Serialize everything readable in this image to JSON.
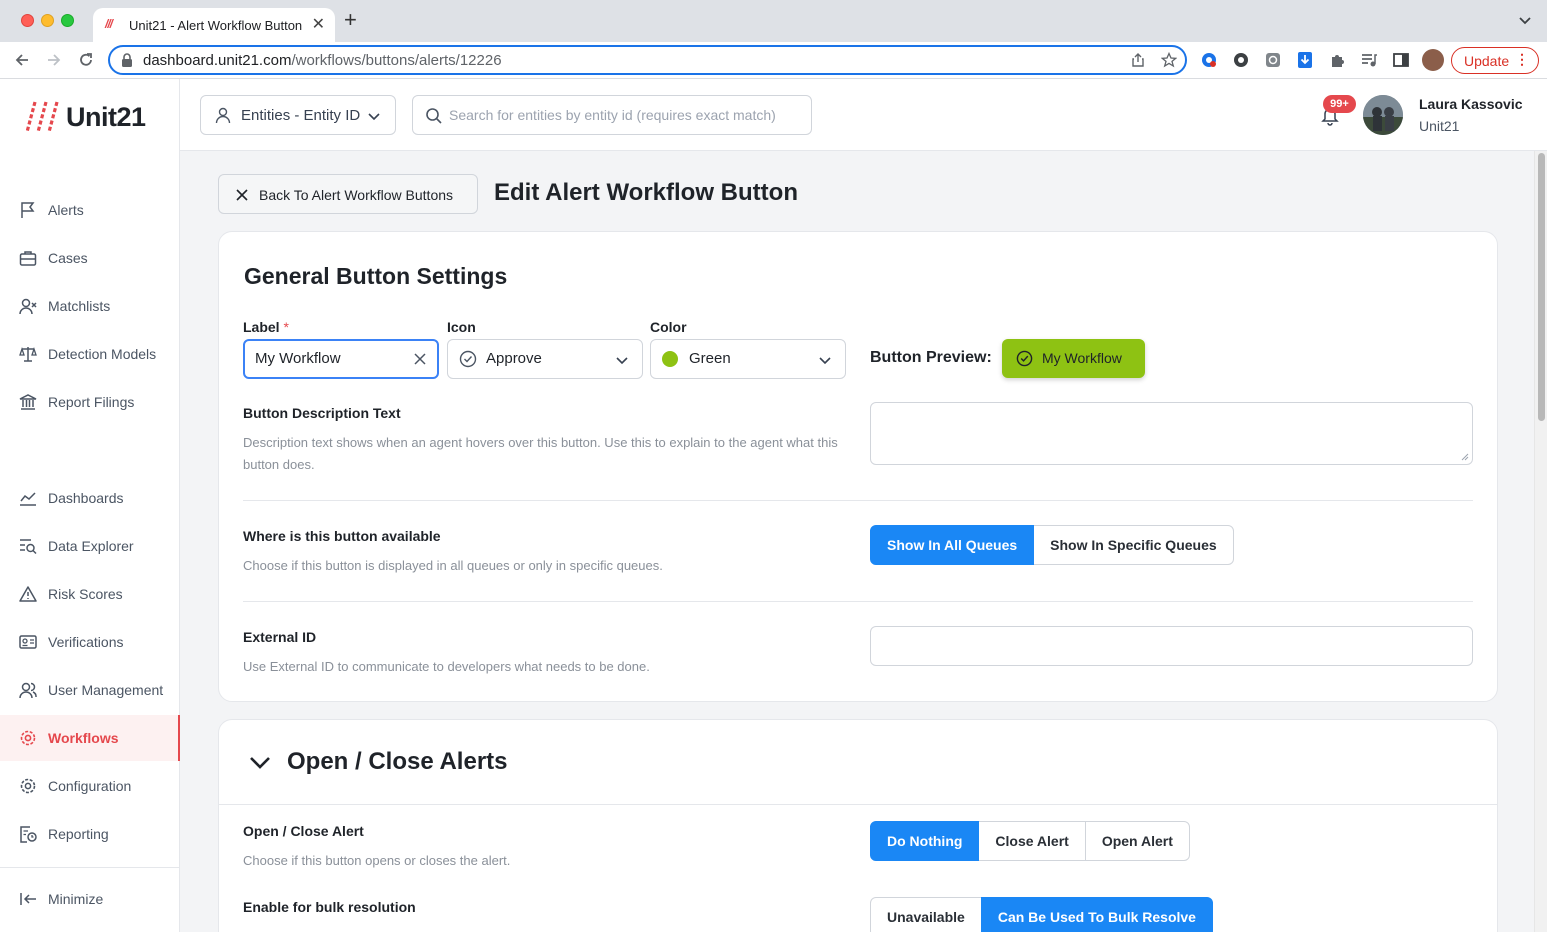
{
  "browser": {
    "tab_title": "Unit21 - Alert Workflow Button",
    "url_host": "dashboard.unit21.com",
    "url_path": "/workflows/buttons/alerts/12226",
    "update_label": "Update"
  },
  "brand": {
    "name": "Unit21",
    "accent": "#e5484d"
  },
  "sidebar": {
    "items": [
      {
        "label": "Alerts",
        "icon": "flag-icon"
      },
      {
        "label": "Cases",
        "icon": "briefcase-icon"
      },
      {
        "label": "Matchlists",
        "icon": "user-x-icon"
      },
      {
        "label": "Detection Models",
        "icon": "scale-icon"
      },
      {
        "label": "Report Filings",
        "icon": "bank-icon"
      },
      {
        "label": "Dashboards",
        "icon": "chart-line-icon"
      },
      {
        "label": "Data Explorer",
        "icon": "data-search-icon"
      },
      {
        "label": "Risk Scores",
        "icon": "warning-icon"
      },
      {
        "label": "Verifications",
        "icon": "id-card-icon"
      },
      {
        "label": "User Management",
        "icon": "users-icon"
      },
      {
        "label": "Workflows",
        "icon": "workflow-gear-icon",
        "active": true
      },
      {
        "label": "Configuration",
        "icon": "gear-icon"
      },
      {
        "label": "Reporting",
        "icon": "report-clock-icon"
      }
    ],
    "minimize_label": "Minimize"
  },
  "topbar": {
    "entity_select_label": "Entities - Entity ID",
    "search_placeholder": "Search for entities by entity id (requires exact match)",
    "notification_count": "99+",
    "user_name": "Laura Kassovic",
    "user_org": "Unit21"
  },
  "page": {
    "back_label": "Back To Alert Workflow Buttons",
    "title": "Edit Alert Workflow Button"
  },
  "general": {
    "title": "General Button Settings",
    "label_field": {
      "label": "Label",
      "required_mark": "*",
      "value": "My Workflow"
    },
    "icon_field": {
      "label": "Icon",
      "value": "Approve"
    },
    "color_field": {
      "label": "Color",
      "value": "Green",
      "swatch": "#8ec213"
    },
    "preview": {
      "label": "Button Preview:",
      "button_label": "My Workflow"
    },
    "description": {
      "label": "Button Description Text",
      "help": "Description text shows when an agent hovers over this button. Use this to explain to the agent what this button does.",
      "value": ""
    },
    "availability": {
      "label": "Where is this button available",
      "help": "Choose if this button is displayed in all queues or only in specific queues.",
      "options": [
        "Show In All Queues",
        "Show In Specific Queues"
      ],
      "selected": "Show In All Queues"
    },
    "external_id": {
      "label": "External ID",
      "help": "Use External ID to communicate to developers what needs to be done.",
      "value": ""
    }
  },
  "open_close": {
    "title": "Open / Close Alerts",
    "alert_action": {
      "label": "Open / Close Alert",
      "help": "Choose if this button opens or closes the alert.",
      "options": [
        "Do Nothing",
        "Close Alert",
        "Open Alert"
      ],
      "selected": "Do Nothing"
    },
    "bulk": {
      "label": "Enable for bulk resolution",
      "options": [
        "Unavailable",
        "Can Be Used To Bulk Resolve"
      ],
      "selected": "Can Be Used To Bulk Resolve"
    }
  }
}
